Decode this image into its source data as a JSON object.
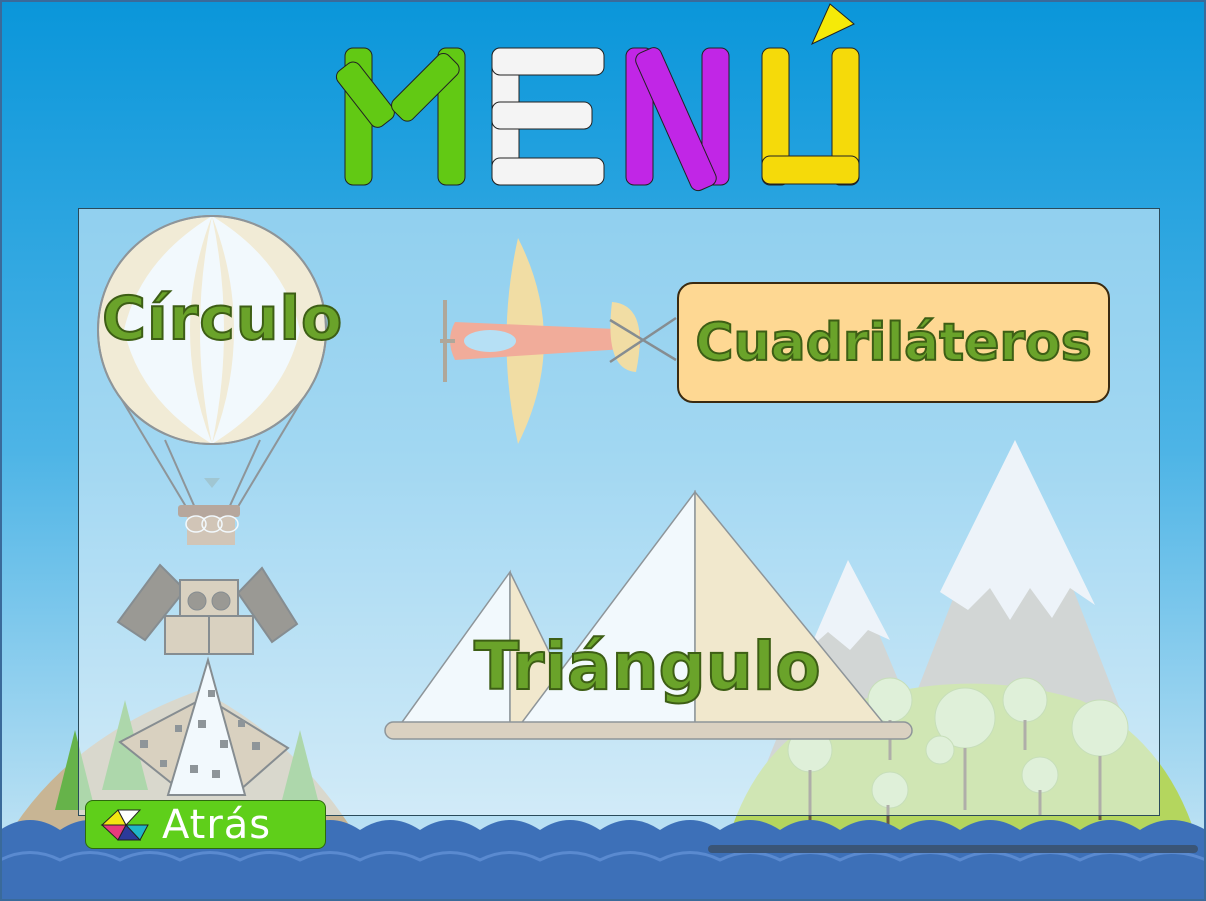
{
  "title": "MENÚ",
  "menu": {
    "circle_label": "Círculo",
    "quadrilaterals_label": "Cuadriláteros",
    "triangle_label": "Triángulo"
  },
  "back_button": {
    "label": "Atrás",
    "icon": "tangram-icon"
  },
  "colors": {
    "sky_top": "#0a96da",
    "sea": "#3d70b8",
    "label_green": "#6aa32a",
    "button_green": "#5fcf1a",
    "box_orange": "#fed893",
    "letter_m": "#62c914",
    "letter_e": "#f4f4f4",
    "letter_n": "#c126e6",
    "letter_u": "#f5da0a"
  }
}
